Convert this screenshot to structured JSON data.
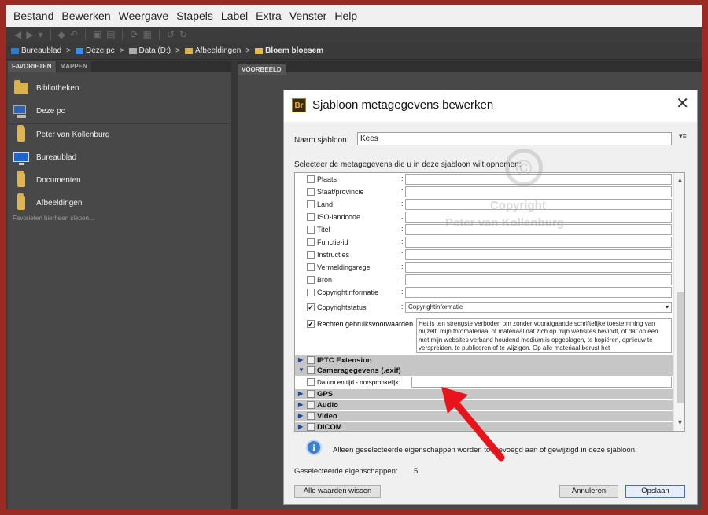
{
  "menu": [
    "Bestand",
    "Bewerken",
    "Weergave",
    "Stapels",
    "Label",
    "Extra",
    "Venster",
    "Help"
  ],
  "breadcrumbs": [
    "Bureaublad",
    "Deze pc",
    "Data (D:)",
    "Afbeeldingen",
    "Bloem bloesem"
  ],
  "left_tabs": [
    "FAVORIETEN",
    "MAPPEN"
  ],
  "favorites": [
    {
      "label": "Bibliotheken",
      "icon": "libraries-icon"
    },
    {
      "label": "Deze pc",
      "icon": "computer-icon"
    },
    {
      "label": "Peter van Kollenburg",
      "icon": "user-folder-icon"
    },
    {
      "label": "Bureaublad",
      "icon": "desktop-icon"
    },
    {
      "label": "Documenten",
      "icon": "documents-folder-icon"
    },
    {
      "label": "Afbeeldingen",
      "icon": "pictures-folder-icon"
    }
  ],
  "favorites_hint": "Favorieten hierheen slepen...",
  "right_tab": "VOORBEELD",
  "dialog": {
    "app_logo": "Br",
    "title": "Sjabloon metagegevens bewerken",
    "name_label": "Naam sjabloon:",
    "name_value": "Kees",
    "select_label": "Selecteer de metagegevens die u in deze sjabloon wilt opnemen:",
    "fields": [
      {
        "label": "Plaats",
        "checked": false
      },
      {
        "label": "Staat/provincie",
        "checked": false
      },
      {
        "label": "Land",
        "checked": false
      },
      {
        "label": "ISO-landcode",
        "checked": false
      },
      {
        "label": "Titel",
        "checked": false
      },
      {
        "label": "Functie-id",
        "checked": false
      },
      {
        "label": "Instructies",
        "checked": false
      },
      {
        "label": "Vermeldingsregel",
        "checked": false
      },
      {
        "label": "Bron",
        "checked": false
      },
      {
        "label": "Copyrightinformatie",
        "checked": false
      }
    ],
    "copyright_status": {
      "label": "Copyrightstatus",
      "value": "Copyrightinformatie",
      "checked": true
    },
    "rights": {
      "label": "Rechten gebruiksvoorwaarden",
      "checked": true,
      "text": "Het is ten strengste verboden om zonder voorafgaande schriftelijke toestemming van mijzelf, mijn fotomateriaal of materiaal dat zich op mijn websites bevindt, of dat op een met mijn websites verband houdend medium is opgeslagen, te kopiëren, opnieuw te verspreiden, te publiceren of te wijzigen. Op alle materiaal berust het"
    },
    "groups": {
      "iptc": "IPTC Extension",
      "camera": "Cameragegevens (.exif)",
      "gps": "GPS",
      "audio": "Audio",
      "video": "Video",
      "dicom": "DICOM"
    },
    "date_label": "Datum en tijd - oorspronkelijk:",
    "watermark": {
      "symbol": "©",
      "line1": "Copyright",
      "line2": "Peter van Kollenburg"
    },
    "info_text": "Alleen geselecteerde eigenschappen worden toegevoegd aan of gewijzigd in deze sjabloon.",
    "count_label": "Geselecteerde eigenschappen:",
    "count_value": "5",
    "buttons": {
      "clear": "Alle waarden wissen",
      "cancel": "Annuleren",
      "save": "Opslaan"
    }
  },
  "colors": {
    "frame": "#9b2a24",
    "app_bg": "#3c3c3c",
    "arrow": "#e8141b"
  }
}
